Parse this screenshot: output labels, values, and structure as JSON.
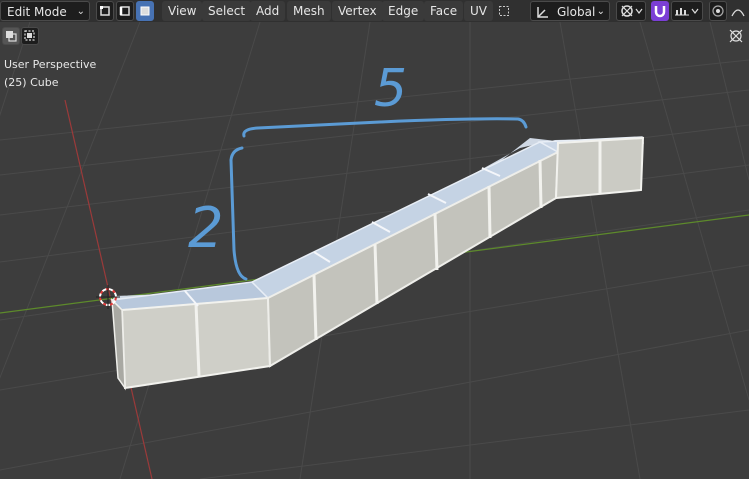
{
  "header": {
    "mode": "Edit Mode",
    "menus": [
      "View",
      "Select",
      "Add",
      "Mesh",
      "Vertex",
      "Edge",
      "Face",
      "UV"
    ],
    "transform_orientation": "Global"
  },
  "overlay": {
    "view_name": "User Perspective",
    "object_name": "(25) Cube"
  },
  "annotations": {
    "width_label": "5",
    "height_label": "2",
    "color": "#5b9bd5"
  },
  "colors": {
    "viewport_bg": "#3d3d3d",
    "grid": "#4a4a4a",
    "x_axis": "#9b3a3a",
    "y_axis": "#5d8a2b",
    "header_bg": "#303030",
    "active_blue": "#4772b3",
    "snap_purple": "#7b3fd6"
  }
}
